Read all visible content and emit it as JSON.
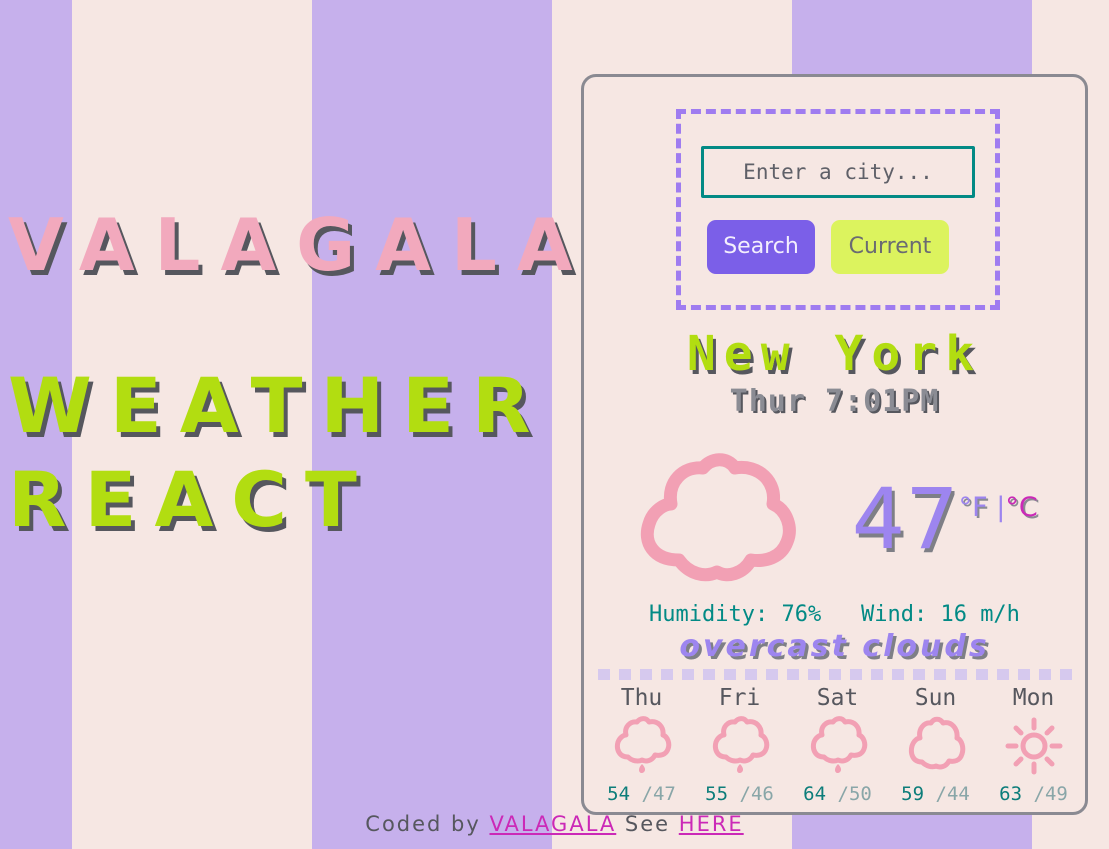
{
  "brand": {
    "title": "VALAGALA",
    "subtitle_line1": "WEATHER",
    "subtitle_line2": "REACT",
    "title_color": "#f2a9bd",
    "subtitle_color": "#b2dd11",
    "shadow_color": "#56575e"
  },
  "background": {
    "stripe_lavender": "#c6b0ec",
    "stripe_cream": "#f6e7e3"
  },
  "search": {
    "placeholder": "Enter a city...",
    "value": "",
    "search_label": "Search",
    "current_label": "Current",
    "search_button_color": "#7b5fe8",
    "current_button_color": "#dcf35e",
    "input_border_color": "#028a85",
    "panel_border_color": "#9f7cf0"
  },
  "current": {
    "city": "New York",
    "datetime": "Thur 7:01PM",
    "temperature": "47",
    "unit_fahrenheit": "°F",
    "unit_separator": " |",
    "unit_celsius": "°C",
    "active_unit": "°F",
    "humidity_label": "Humidity: 76%",
    "wind_label": "Wind: 16 m/h",
    "description": "overcast clouds",
    "icon": "cloud-icon",
    "icon_color": "#f2a0b4",
    "temp_color": "#9d85ef",
    "celsius_color": "#cb29b7",
    "stat_color": "#028a85"
  },
  "forecast": [
    {
      "day": "Thu",
      "icon": "rain-cloud-icon",
      "high": "54",
      "low": "/47"
    },
    {
      "day": "Fri",
      "icon": "rain-cloud-icon",
      "high": "55",
      "low": "/46"
    },
    {
      "day": "Sat",
      "icon": "rain-cloud-icon",
      "high": "64",
      "low": "/50"
    },
    {
      "day": "Sun",
      "icon": "cloud-icon",
      "high": "59",
      "low": "/44"
    },
    {
      "day": "Mon",
      "icon": "sun-icon",
      "high": "63",
      "low": "/49"
    }
  ],
  "footer": {
    "prefix": "Coded by ",
    "author_link": "VALAGALA",
    "middle": " See ",
    "source_link": "HERE",
    "link_color": "#cb29b7"
  }
}
